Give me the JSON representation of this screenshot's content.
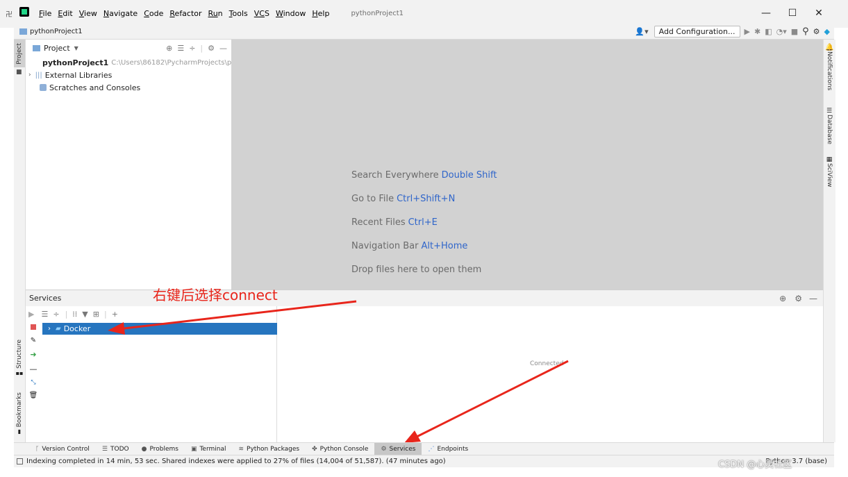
{
  "menu": {
    "items": [
      {
        "u": "F",
        "rest": "ile"
      },
      {
        "u": "E",
        "rest": "dit"
      },
      {
        "u": "V",
        "rest": "iew"
      },
      {
        "u": "N",
        "rest": "avigate"
      },
      {
        "u": "C",
        "rest": "ode"
      },
      {
        "u": "R",
        "rest": "efactor"
      },
      {
        "u": "Ru",
        "rest": "n"
      },
      {
        "u": "T",
        "rest": "ools"
      },
      {
        "u": "VC",
        "rest": "S"
      },
      {
        "u": "W",
        "rest": "indow"
      },
      {
        "u": "H",
        "rest": "elp"
      }
    ],
    "project_title": "pythonProject1"
  },
  "window_controls": {
    "minimize": "—",
    "maximize": "☐",
    "close": "✕"
  },
  "navbar": {
    "breadcrumb": "pythonProject1",
    "add_config": "Add Configuration..."
  },
  "left_stripe": {
    "project": "Project",
    "structure": "Structure",
    "bookmarks": "Bookmarks"
  },
  "right_stripe": {
    "notifications": "Notifications",
    "database": "Database",
    "sciview": "SciView"
  },
  "project_panel": {
    "header": "Project",
    "root_name": "pythonProject1",
    "root_path": "C:\\Users\\86182\\PycharmProjects\\p",
    "external_libraries": "External Libraries",
    "scratches": "Scratches and Consoles"
  },
  "editor": {
    "hints": [
      {
        "text": "Search Everywhere",
        "key": "Double Shift"
      },
      {
        "text": "Go to File",
        "key": "Ctrl+Shift+N"
      },
      {
        "text": "Recent Files",
        "key": "Ctrl+E"
      },
      {
        "text": "Navigation Bar",
        "key": "Alt+Home"
      },
      {
        "text": "Drop files here to open them",
        "key": ""
      }
    ]
  },
  "annotation": {
    "text": "右键后选择connect",
    "color": "#e8251b"
  },
  "services": {
    "title": "Services",
    "docker": "Docker",
    "status": "Connected"
  },
  "bottom_tabs": [
    {
      "label": "Version Control",
      "icon": "branch-icon"
    },
    {
      "label": "TODO",
      "icon": "list-icon"
    },
    {
      "label": "Problems",
      "icon": "warning-icon"
    },
    {
      "label": "Terminal",
      "icon": "terminal-icon"
    },
    {
      "label": "Python Packages",
      "icon": "layers-icon"
    },
    {
      "label": "Python Console",
      "icon": "python-icon"
    },
    {
      "label": "Services",
      "icon": "services-icon",
      "active": true
    },
    {
      "label": "Endpoints",
      "icon": "endpoints-icon"
    }
  ],
  "statusbar": {
    "message": "Indexing completed in 14 min, 53 sec. Shared indexes were applied to 27% of files (14,004 of 51,587). (47 minutes ago)",
    "interpreter": "Python 3.7 (base)",
    "watermark": "CSDN @心灵社区"
  },
  "colors": {
    "accent_blue": "#2f65ca",
    "selection": "#2675bf",
    "arrow_red": "#e8251b",
    "editor_bg": "#d2d2d2"
  }
}
